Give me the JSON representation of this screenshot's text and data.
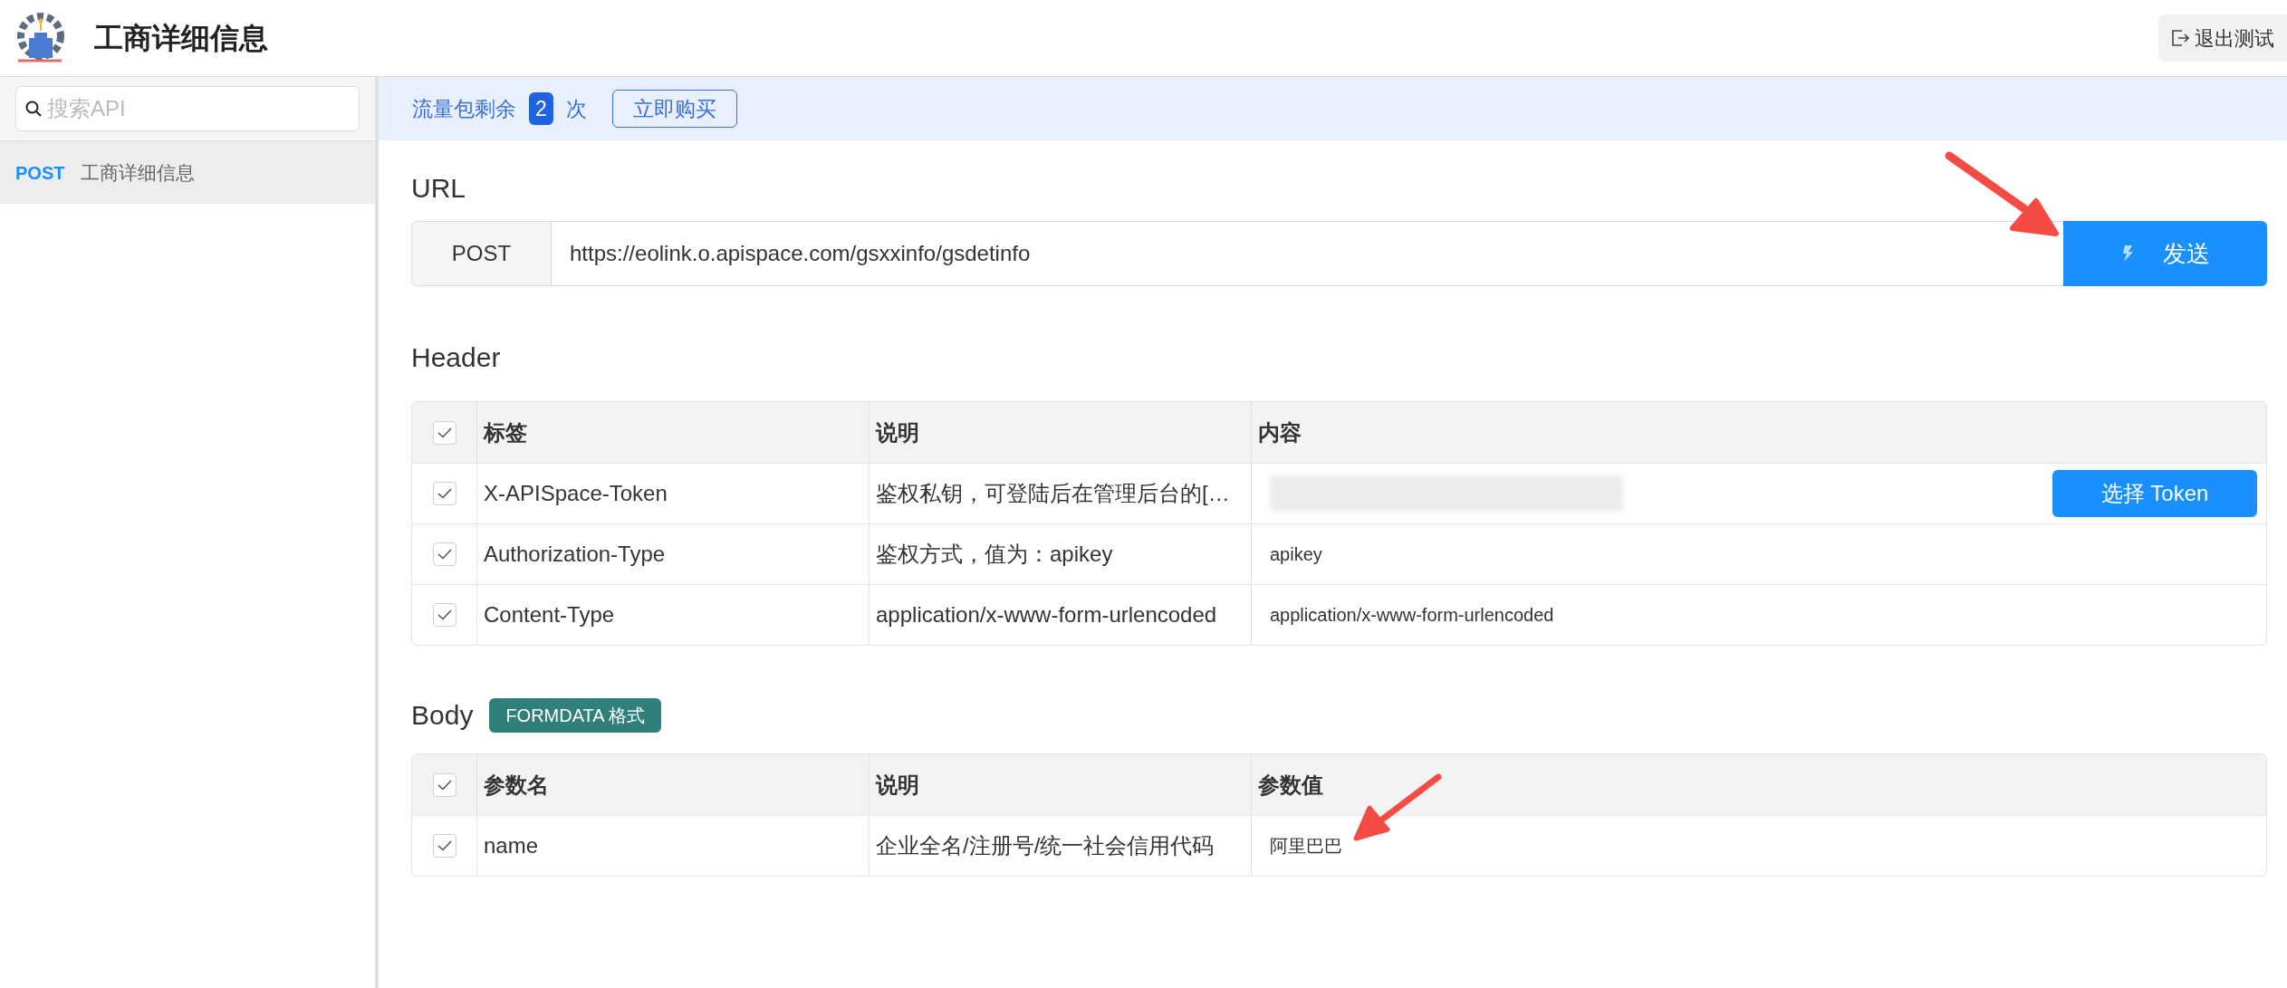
{
  "app": {
    "title": "工商详细信息",
    "exit_button": "退出测试"
  },
  "sidebar": {
    "search": {
      "placeholder": "搜索API"
    },
    "items": [
      {
        "method": "POST",
        "name": "工商详细信息",
        "selected": true
      }
    ]
  },
  "quota": {
    "label": "流量包剩余",
    "count": "2",
    "unit": "次",
    "buy_button": "立即购买"
  },
  "url": {
    "heading": "URL",
    "method": "POST",
    "value": "https://eolink.o.apispace.com/gsxxinfo/gsdetinfo",
    "send_button": "发送"
  },
  "header": {
    "heading": "Header",
    "all_checked": true,
    "columns": [
      "标签",
      "说明",
      "内容"
    ],
    "rows": [
      {
        "kind": "token",
        "checked": true,
        "name": "X-APISpace-Token",
        "description": "鉴权私钥，可登陆后在管理后台的[…",
        "action": "选择 Token"
      },
      {
        "kind": "text",
        "checked": true,
        "name": "Authorization-Type",
        "description": "鉴权方式，值为：apikey",
        "value": "apikey"
      },
      {
        "kind": "text",
        "checked": true,
        "name": "Content-Type",
        "description": "application/x-www-form-urlencoded",
        "value": "application/x-www-form-urlencoded"
      }
    ]
  },
  "body": {
    "heading": "Body",
    "format_badge": "FORMDATA 格式",
    "all_checked": true,
    "columns": [
      "参数名",
      "说明",
      "参数值"
    ],
    "rows": [
      {
        "kind": "text",
        "checked": true,
        "name": "name",
        "description": "企业全名/注册号/统一社会信用代码",
        "value": "阿里巴巴"
      }
    ]
  }
}
